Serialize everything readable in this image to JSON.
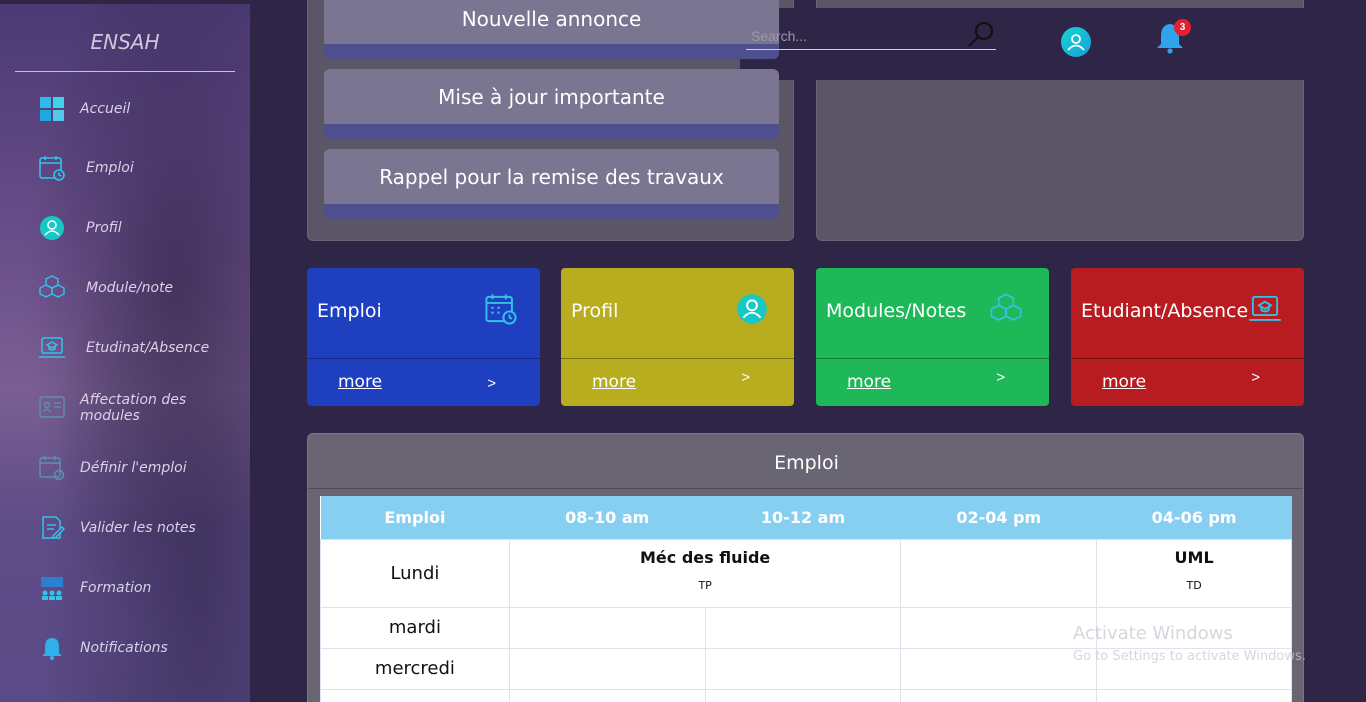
{
  "sidebar": {
    "brand": "ENSAH",
    "items": [
      {
        "label": "Accueil",
        "icon": "dashboard-icon"
      },
      {
        "label": "Emploi",
        "icon": "calendar-icon"
      },
      {
        "label": "Profil",
        "icon": "user-icon"
      },
      {
        "label": "Module/note",
        "icon": "cubes-icon"
      },
      {
        "label": "Etudinat/Absence",
        "icon": "laptop-student-icon"
      },
      {
        "label": "Affectation des modules",
        "icon": "assign-icon"
      },
      {
        "label": "Définir l'emploi",
        "icon": "calendar-edit-icon"
      },
      {
        "label": "Valider les notes",
        "icon": "document-edit-icon"
      },
      {
        "label": "Formation",
        "icon": "training-icon"
      },
      {
        "label": "Notifications",
        "icon": "bell-icon"
      }
    ]
  },
  "announcements": [
    "Nouvelle annonce",
    "Mise à jour importante",
    "Rappel pour la remise des travaux"
  ],
  "header": {
    "search_placeholder": "Search...",
    "notification_count": "3"
  },
  "cards": [
    {
      "title": "Emploi",
      "more": "more",
      "arrow": ">",
      "color": "#1e3fbf",
      "icon": "calendar-icon"
    },
    {
      "title": "Profil",
      "more": "more",
      "arrow": ">",
      "color": "#b8ac1f",
      "icon": "user-icon"
    },
    {
      "title": "Modules/Notes",
      "more": "more",
      "arrow": ">",
      "color": "#1fb858",
      "icon": "cubes-icon"
    },
    {
      "title": "Etudiant/Absence",
      "more": "more",
      "arrow": ">",
      "color": "#b81c20",
      "icon": "laptop-student-icon"
    }
  ],
  "schedule": {
    "title": "Emploi",
    "headers": [
      "Emploi",
      "08-10 am",
      "10-12 am",
      "02-04 pm",
      "04-06 pm"
    ],
    "rows": [
      {
        "day": "Lundi",
        "c1_name": "Méc des fluide",
        "c1_type": "TP",
        "c2_name": "UML",
        "c2_type": "TD"
      },
      {
        "day": "mardi"
      },
      {
        "day": "mercredi"
      }
    ]
  },
  "watermark": {
    "line1": "Activate Windows",
    "line2": "Go to Settings to activate Windows."
  }
}
